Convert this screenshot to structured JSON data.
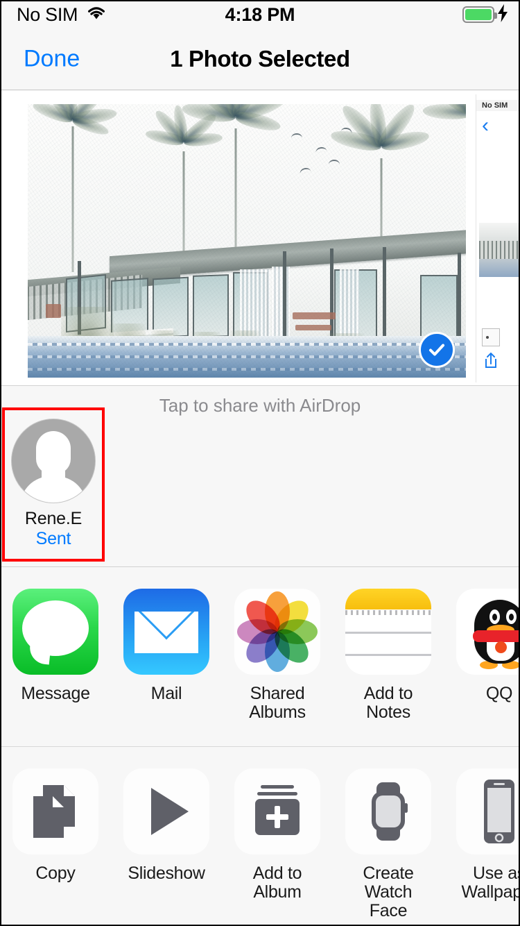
{
  "status_bar": {
    "carrier": "No SIM",
    "time": "4:18 PM",
    "wifi_icon": "wifi-icon",
    "battery_icon": "battery-full-icon",
    "charging_icon": "lightning-bolt-icon",
    "battery_color": "#4CD964"
  },
  "nav_bar": {
    "done_label": "Done",
    "title": "1 Photo Selected",
    "accent_color": "#007AFF"
  },
  "preview": {
    "photo_name": "photo-thumbnail",
    "selected": true,
    "checkmark_icon": "checkmark-circle-icon",
    "checkmark_color": "#1374E8",
    "next_card": {
      "mini_carrier": "No SIM",
      "back_icon": "chevron-left-icon",
      "share_icon": "share-arrow-icon"
    }
  },
  "airdrop": {
    "hint": "Tap to share with AirDrop",
    "highlight_color": "#ff0000",
    "contacts": [
      {
        "name": "Rene.E",
        "status": "Sent",
        "status_color": "#007AFF",
        "avatar_icon": "person-silhouette-icon",
        "highlighted": true
      }
    ]
  },
  "app_row": {
    "items": [
      {
        "label": "Message",
        "icon": "messages-app-icon"
      },
      {
        "label": "Mail",
        "icon": "mail-app-icon"
      },
      {
        "label": "Shared Albums",
        "icon": "photos-app-icon"
      },
      {
        "label": "Add to Notes",
        "icon": "notes-app-icon"
      },
      {
        "label": "QQ",
        "icon": "qq-app-icon"
      }
    ]
  },
  "action_row": {
    "items": [
      {
        "label": "Copy",
        "icon": "copy-icon"
      },
      {
        "label": "Slideshow",
        "icon": "play-triangle-icon"
      },
      {
        "label": "Add to Album",
        "icon": "add-to-album-icon"
      },
      {
        "label": "Create Watch Face",
        "icon": "apple-watch-icon"
      },
      {
        "label": "Use as Wallpaper",
        "icon": "iphone-icon"
      }
    ]
  }
}
